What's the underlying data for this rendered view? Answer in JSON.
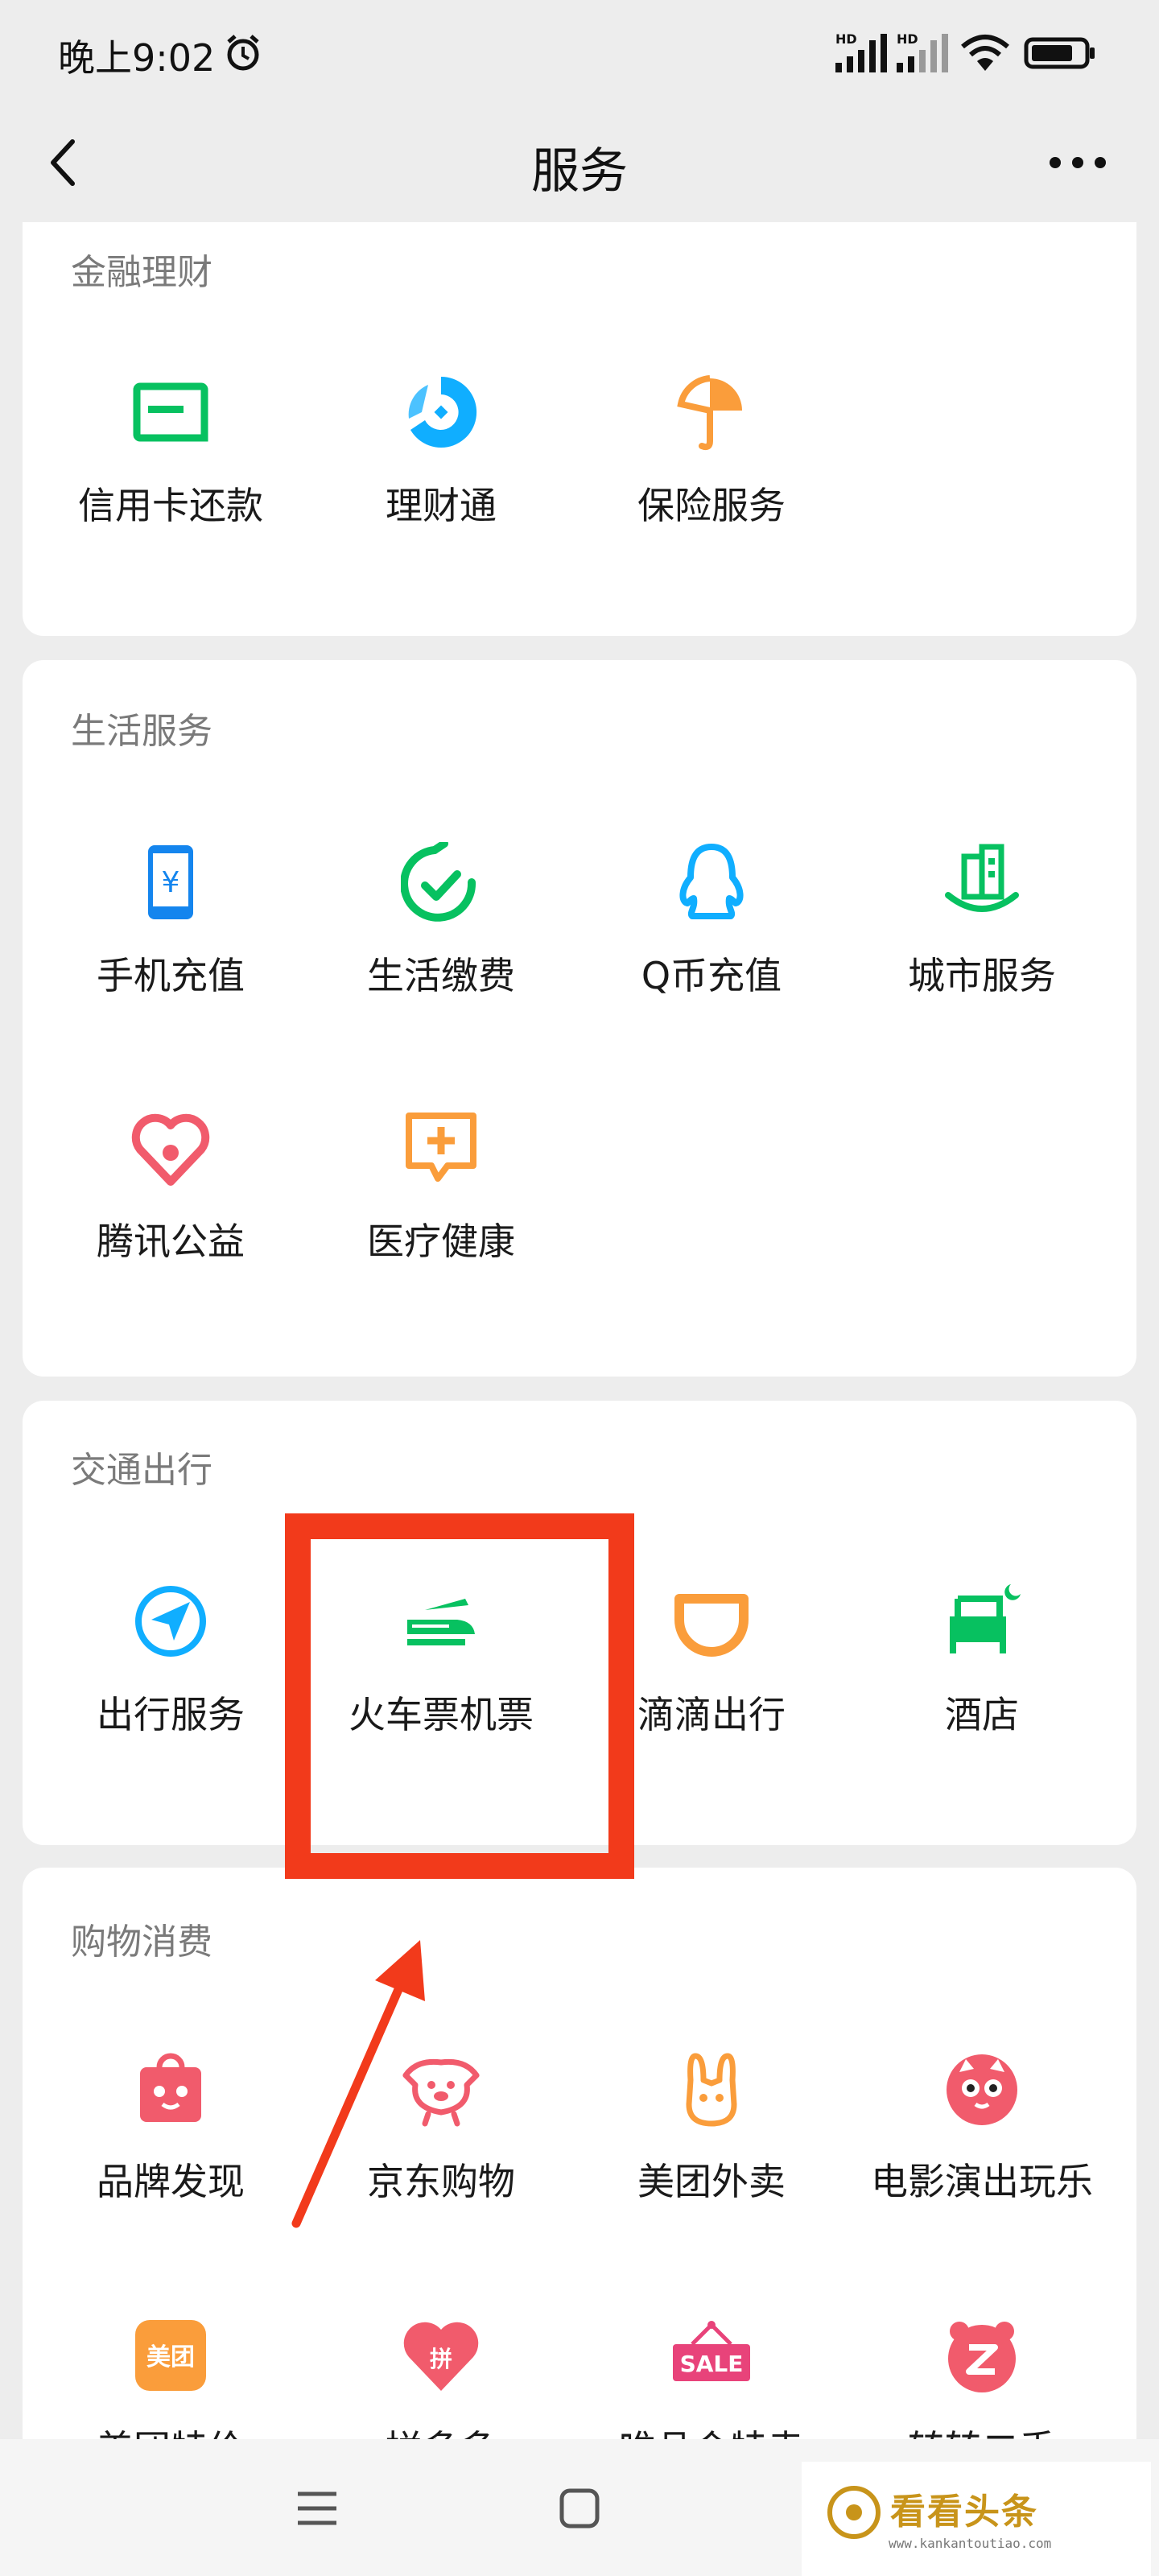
{
  "status": {
    "time": "晚上9:02",
    "sig1": "HD",
    "sig2": "HD"
  },
  "nav": {
    "title": "服务"
  },
  "sections": [
    {
      "title": "金融理财",
      "items": [
        {
          "label": "信用卡还款",
          "icon": "credit-card-icon",
          "color": "#07c160"
        },
        {
          "label": "理财通",
          "icon": "wealth-icon",
          "color": "#10aeff"
        },
        {
          "label": "保险服务",
          "icon": "umbrella-icon",
          "color": "#fa9d3b"
        }
      ]
    },
    {
      "title": "生活服务",
      "items": [
        {
          "label": "手机充值",
          "icon": "phone-topup-icon",
          "color": "#1485ee"
        },
        {
          "label": "生活缴费",
          "icon": "utility-bill-icon",
          "color": "#07c160"
        },
        {
          "label": "Q币充值",
          "icon": "qq-coin-icon",
          "color": "#10aeff"
        },
        {
          "label": "城市服务",
          "icon": "city-service-icon",
          "color": "#07c160"
        },
        {
          "label": "腾讯公益",
          "icon": "charity-heart-icon",
          "color": "#f15b6c"
        },
        {
          "label": "医疗健康",
          "icon": "medical-icon",
          "color": "#fa9d3b"
        }
      ]
    },
    {
      "title": "交通出行",
      "items": [
        {
          "label": "出行服务",
          "icon": "travel-navigation-icon",
          "color": "#10aeff"
        },
        {
          "label": "火车票机票",
          "icon": "train-plane-icon",
          "color": "#07c160"
        },
        {
          "label": "滴滴出行",
          "icon": "didi-icon",
          "color": "#fa9d3b"
        },
        {
          "label": "酒店",
          "icon": "hotel-bed-icon",
          "color": "#07c160"
        }
      ]
    },
    {
      "title": "购物消费",
      "items": [
        {
          "label": "品牌发现",
          "icon": "brand-bag-icon",
          "color": "#f15b6c"
        },
        {
          "label": "京东购物",
          "icon": "jd-dog-icon",
          "color": "#f15b6c"
        },
        {
          "label": "美团外卖",
          "icon": "meituan-rabbit-icon",
          "color": "#fa9d3b"
        },
        {
          "label": "电影演出玩乐",
          "icon": "movie-cat-icon",
          "color": "#f15b6c"
        },
        {
          "label": "美团特价",
          "icon": "meituan-logo-icon",
          "color": "#fa9d3b"
        },
        {
          "label": "拼多多",
          "icon": "pinduoduo-icon",
          "color": "#f15b6c"
        },
        {
          "label": "唯品会特卖",
          "icon": "sale-tag-icon",
          "color": "#e8437a"
        },
        {
          "label": "转转二手",
          "icon": "zhuanzhuan-icon",
          "color": "#f15b6c"
        }
      ]
    }
  ],
  "badges": {
    "meituan_logo": "美团",
    "pdd": "拼",
    "sale": "SALE"
  },
  "watermark": {
    "main": "看看头条",
    "sub": "www.kankantoutiao.com"
  }
}
